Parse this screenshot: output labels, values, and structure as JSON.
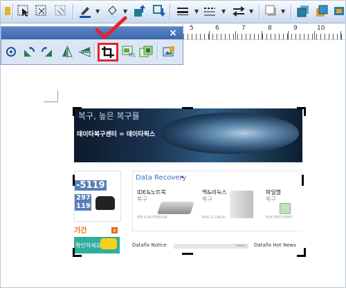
{
  "toolbar": {
    "buttons": [
      {
        "name": "select-objects-icon"
      },
      {
        "name": "select-grouped-icon"
      },
      {
        "name": "select-cells-icon"
      },
      {
        "name": "line-color-icon"
      },
      {
        "name": "fill-color-icon"
      },
      {
        "name": "bring-forward-icon"
      },
      {
        "name": "send-backward-icon"
      },
      {
        "name": "line-style-icon"
      },
      {
        "name": "dash-style-icon"
      },
      {
        "name": "arrow-style-icon"
      },
      {
        "name": "shadow-icon"
      },
      {
        "name": "3d-style-icon"
      },
      {
        "name": "wrap-icon"
      }
    ]
  },
  "ruler": {
    "labels": [
      "5",
      "6",
      "7",
      "8",
      "9",
      "10"
    ]
  },
  "picture_toolbar": {
    "close_label": "×",
    "buttons": [
      {
        "name": "reset-picture-icon"
      },
      {
        "name": "rotate-left-icon"
      },
      {
        "name": "rotate-right-icon"
      },
      {
        "name": "flip-horizontal-icon"
      },
      {
        "name": "flip-vertical-icon"
      },
      {
        "name": "crop-icon",
        "highlighted": true
      },
      {
        "name": "picture-style-icon",
        "label": "가1"
      },
      {
        "name": "insert-picture-icon"
      },
      {
        "name": "picture-format-icon"
      }
    ],
    "highlight_color": "#e8202a"
  },
  "picture": {
    "banner_line1": "복구, 높은 복구율",
    "banner_line2": "데이타복구센터 = 데이타픽스",
    "phone1": "-5119",
    "phone2a": "2977",
    "phone2b": "119",
    "time_label": "기간",
    "green_label": "확인하세요",
    "section_title": "Data Recovery",
    "items": [
      {
        "title": "IDE&노트북",
        "sub": "복구",
        "small": "IDE & NOTEBOOK"
      },
      {
        "title": "맥&리눅스",
        "sub": "복구",
        "small": "MAC & LINUX"
      },
      {
        "title": "파일별",
        "sub": "복구",
        "small": "FILE RECOVERY"
      }
    ],
    "news_left": "Datafix Notice",
    "news_more": "more",
    "news_right": "Datafix Hot News"
  }
}
